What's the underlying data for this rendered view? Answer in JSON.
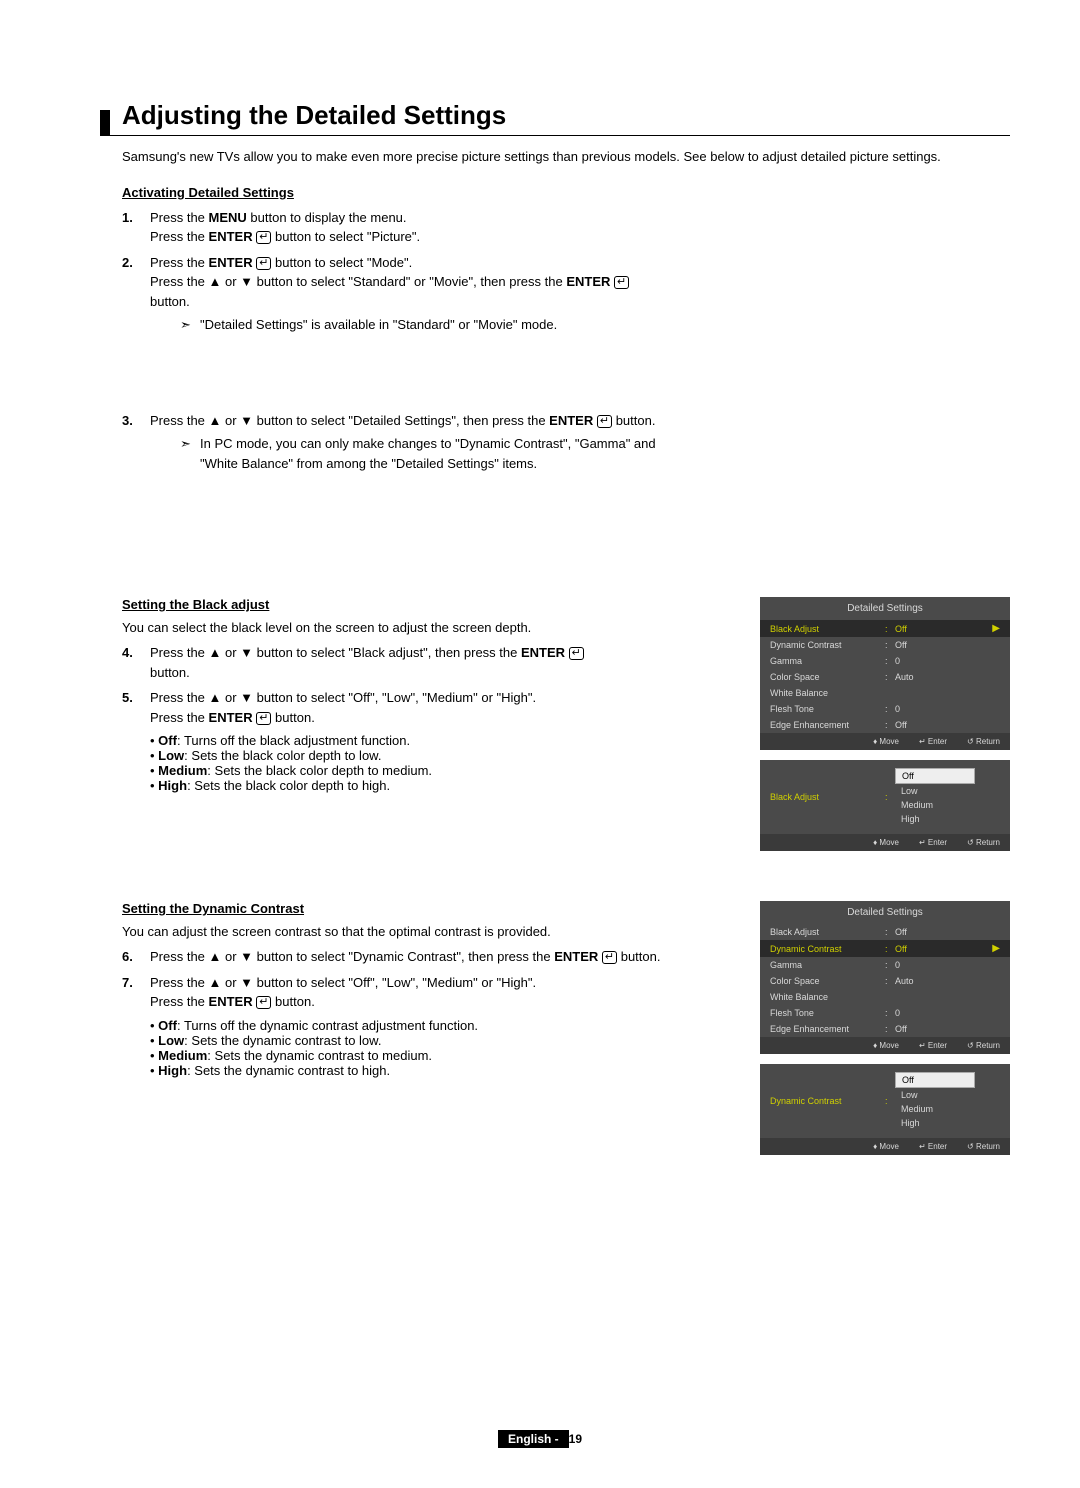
{
  "title": "Adjusting the Detailed Settings",
  "intro": "Samsung's new TVs allow you to make even more precise picture settings than previous models. See below to adjust detailed picture settings.",
  "sec1": {
    "heading": "Activating Detailed Settings",
    "step1_a": "Press the ",
    "step1_menu": "MENU",
    "step1_b": " button to display the menu.",
    "step1_c": "Press the ",
    "step1_enter": "ENTER",
    "step1_d": " button to select \"Picture\".",
    "step2_a": "Press the ",
    "step2_enter": "ENTER",
    "step2_b": " button to select \"Mode\".",
    "step2_c": "Press the ▲ or ▼ button to select \"Standard\" or \"Movie\", then press the ",
    "step2_enter2": "ENTER",
    "step2_d": " button.",
    "note1": "\"Detailed Settings\" is available in \"Standard\" or \"Movie\" mode.",
    "step3_a": "Press the ▲ or ▼ button to select \"Detailed Settings\", then press the ",
    "step3_enter": "ENTER",
    "step3_b": " button.",
    "note2": "In PC mode, you can only make changes to \"Dynamic Contrast\", \"Gamma\" and \"White Balance\" from among the \"Detailed Settings\" items."
  },
  "sec2": {
    "heading": "Setting the Black adjust",
    "desc": "You can select the black level on the screen to adjust the screen depth.",
    "step4_a": "Press the ▲ or ▼ button to select \"Black adjust\", then press the ",
    "step4_enter": "ENTER",
    "step4_b": " button.",
    "step5_a": "Press the ▲ or ▼ button to select \"Off\", \"Low\", \"Medium\" or \"High\".",
    "step5_b": "Press the ",
    "step5_enter": "ENTER",
    "step5_c": " button.",
    "b_off_l": "Off",
    "b_off_t": ": Turns off the black adjustment function.",
    "b_low_l": "Low",
    "b_low_t": ": Sets the black color depth to low.",
    "b_med_l": "Medium",
    "b_med_t": ": Sets the black color depth to medium.",
    "b_high_l": "High",
    "b_high_t": ": Sets the black color depth to high."
  },
  "sec3": {
    "heading": "Setting the Dynamic Contrast",
    "desc": "You can adjust the screen contrast so that the optimal contrast is provided.",
    "step6_a": "Press the ▲ or ▼ button to select \"Dynamic Contrast\", then press the ",
    "step6_enter": "ENTER",
    "step6_b": " button.",
    "step7_a": "Press the ▲ or ▼ button to select \"Off\", \"Low\", \"Medium\" or \"High\".",
    "step7_b": "Press the ",
    "step7_enter": "ENTER",
    "step7_c": " button.",
    "b_off_l": "Off",
    "b_off_t": ": Turns off the dynamic contrast adjustment function.",
    "b_low_l": "Low",
    "b_low_t": ": Sets the dynamic contrast to low.",
    "b_med_l": "Medium",
    "b_med_t": ": Sets the dynamic contrast to medium.",
    "b_high_l": "High",
    "b_high_t": ": Sets the dynamic contrast to high."
  },
  "osd1": {
    "title": "Detailed Settings",
    "rows": [
      {
        "label": "Black Adjust",
        "value": "Off",
        "sel": true
      },
      {
        "label": "Dynamic Contrast",
        "value": "Off"
      },
      {
        "label": "Gamma",
        "value": "0"
      },
      {
        "label": "Color Space",
        "value": "Auto"
      },
      {
        "label": "White Balance",
        "value": ""
      },
      {
        "label": "Flesh Tone",
        "value": "0"
      },
      {
        "label": "Edge Enhancement",
        "value": "Off"
      }
    ],
    "footer": {
      "move": "Move",
      "enter": "Enter",
      "return": "Return"
    }
  },
  "osd2": {
    "label": "Black Adjust",
    "options": [
      "Off",
      "Low",
      "Medium",
      "High"
    ],
    "selected": "Off",
    "footer": {
      "move": "Move",
      "enter": "Enter",
      "return": "Return"
    }
  },
  "osd3": {
    "title": "Detailed Settings",
    "rows": [
      {
        "label": "Black Adjust",
        "value": "Off"
      },
      {
        "label": "Dynamic Contrast",
        "value": "Off",
        "sel": true
      },
      {
        "label": "Gamma",
        "value": "0"
      },
      {
        "label": "Color Space",
        "value": "Auto"
      },
      {
        "label": "White Balance",
        "value": ""
      },
      {
        "label": "Flesh Tone",
        "value": "0"
      },
      {
        "label": "Edge Enhancement",
        "value": "Off"
      }
    ],
    "footer": {
      "move": "Move",
      "enter": "Enter",
      "return": "Return"
    }
  },
  "osd4": {
    "label": "Dynamic Contrast",
    "options": [
      "Off",
      "Low",
      "Medium",
      "High"
    ],
    "selected": "Off",
    "footer": {
      "move": "Move",
      "enter": "Enter",
      "return": "Return"
    }
  },
  "footer_lang": "English - ",
  "footer_page": "19"
}
